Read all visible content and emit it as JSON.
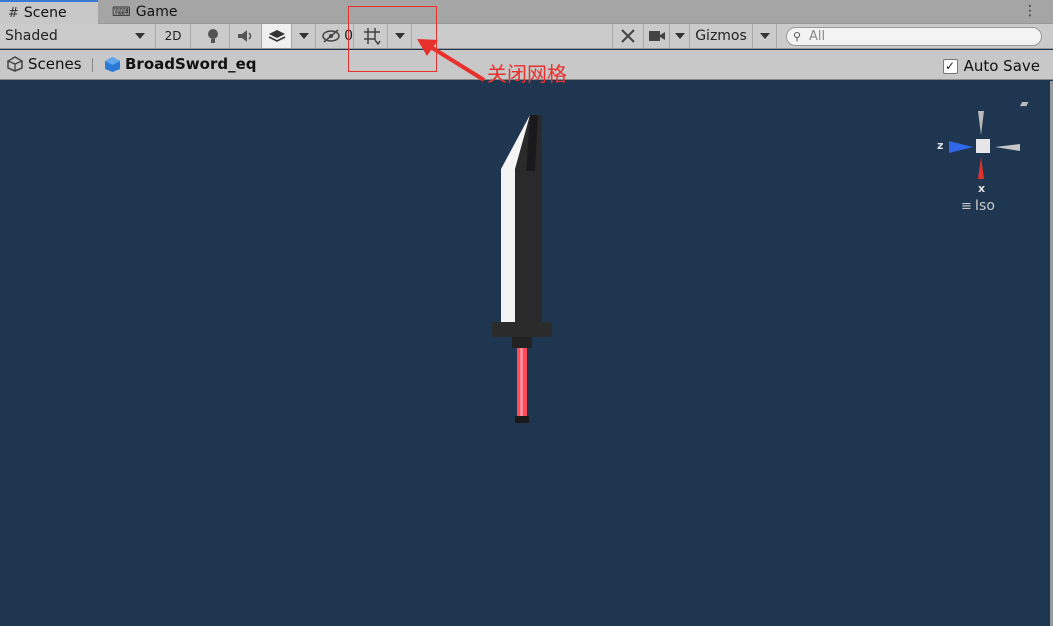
{
  "tabs": {
    "scene": {
      "icon": "#",
      "label": "Scene"
    },
    "game": {
      "icon": "⌨",
      "label": "Game"
    },
    "more_icon": "⋮"
  },
  "toolbar": {
    "shading_mode": "Shaded",
    "mode_2d": "2D",
    "hidden_count": "0",
    "gizmos_label": "Gizmos",
    "search_placeholder": "All"
  },
  "breadcrumb": {
    "root": "Scenes",
    "prefab": "BroadSword_eq",
    "autosave_label": "Auto Save",
    "autosave_checked": true
  },
  "gizmo": {
    "axis_z": "z",
    "axis_x": "x",
    "projection_label": "Iso"
  },
  "annotation": {
    "text": "关闭网格",
    "color": "#e8302c"
  },
  "colors": {
    "viewport_bg": "#1f3650",
    "blade_light": "#f4f4f4",
    "blade_dark": "#2a2a2a",
    "grip": "#ff4a5a"
  }
}
